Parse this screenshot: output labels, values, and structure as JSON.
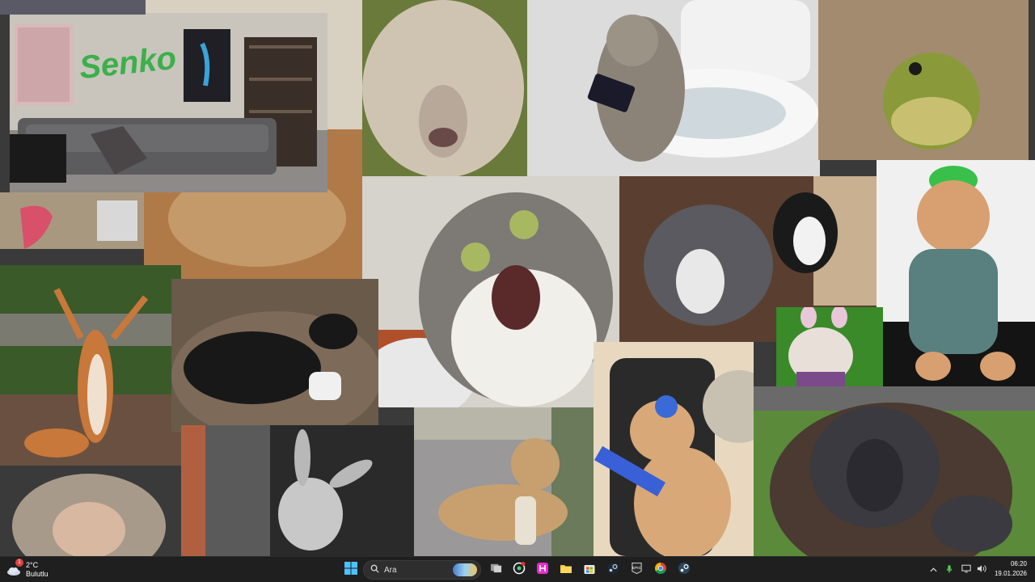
{
  "desktop": {
    "wallpaper_description_items": [
      "room-photo",
      "sheep-photo",
      "cat-toilet-photo",
      "frog-photo",
      "squirrel-photo",
      "black-dog-photo",
      "shocked-cat-photo",
      "pitbull-cat-photo",
      "hat-cat-photo",
      "bunny-dog-photo",
      "monkey-photo",
      "donkey-photo",
      "dog-photo",
      "gamer-cat-photo",
      "orangutan-photo"
    ],
    "room_sign": "Senko"
  },
  "taskbar": {
    "weather": {
      "temp": "2°C",
      "condition": "Bulutlu",
      "badge": "1"
    },
    "search": {
      "placeholder": "Ara"
    },
    "apps": [
      "windows-start",
      "search",
      "task-view",
      "recording",
      "app-pink",
      "file-explorer",
      "store",
      "steam",
      "epic-games",
      "chrome",
      "steam-alt"
    ],
    "tray": {
      "chevron": "^",
      "mic": "mic",
      "display": "display",
      "volume": "volume"
    },
    "clock": {
      "time": "06:20",
      "date": "19.01.2026"
    }
  },
  "colors": {
    "taskbar_bg": "#1f1f1f",
    "accent": "#0078d4"
  }
}
